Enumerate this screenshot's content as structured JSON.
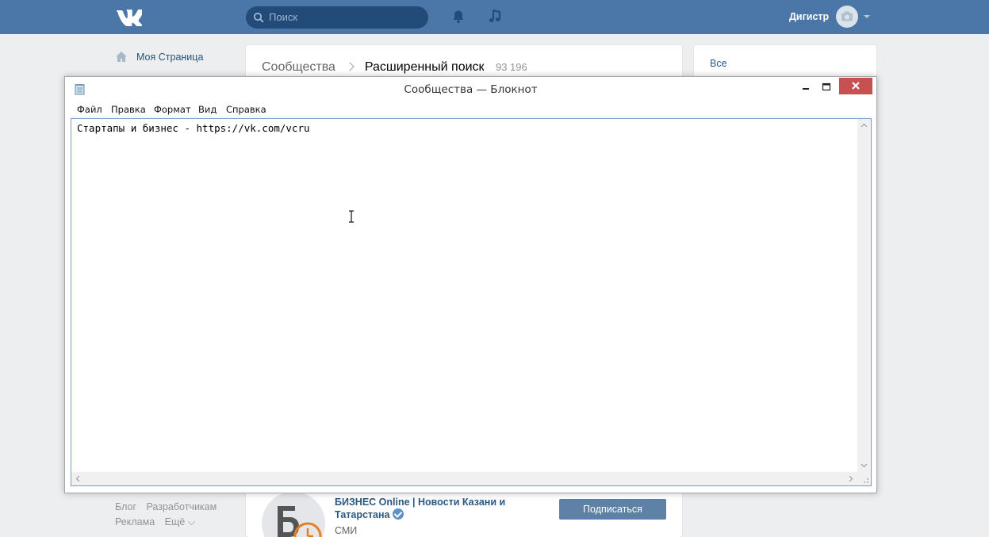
{
  "vk": {
    "search_placeholder": "Поиск",
    "user_name": "Дигистр",
    "left_menu": {
      "my_page": "Моя Страница"
    },
    "footer": {
      "blog": "Блог",
      "developers": "Разработчикам",
      "ads": "Реклама",
      "more": "Ещё ⌵"
    },
    "breadcrumb": {
      "root": "Сообщества",
      "current": "Расширенный поиск",
      "count": "93 196"
    },
    "filter": {
      "all": "Все"
    },
    "community": {
      "name": "БИЗНЕС Online | Новости Казани и Татарстана",
      "category": "СМИ",
      "subscribe": "Подписаться"
    },
    "colors": {
      "brand": "#4a76a8",
      "link": "#2a5885"
    }
  },
  "notepad": {
    "title": "Сообщества — Блокнот",
    "menu": [
      "Файл",
      "Правка",
      "Формат",
      "Вид",
      "Справка"
    ],
    "content": "Стартапы и бизнес - https://vk.com/vcru"
  }
}
